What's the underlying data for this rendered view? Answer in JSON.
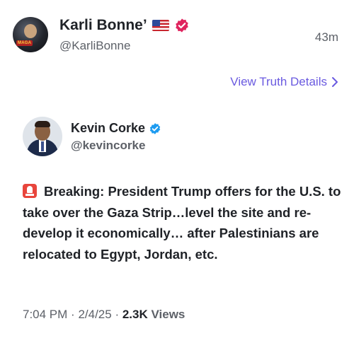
{
  "header": {
    "display_name": "Karli Bonne’",
    "flag_icon": "us-flag-icon",
    "verified_icon": "verified-badge-icon",
    "verified_color": "#e0245e",
    "handle": "@KarliBonne",
    "time_ago": "43m",
    "avatar_badge_text": "MAGA"
  },
  "view_details": {
    "label": "View Truth Details",
    "color": "#6a5ae0"
  },
  "quoted_post": {
    "author_name": "Kevin Corke",
    "verified_color": "#1d9bf0",
    "handle": "@kevincorke",
    "siren_icon": "siren-emoji-icon",
    "body": "Breaking: President Trump offers for the U.S. to take over the Gaza Strip…level the site and re-develop it economically… after Palestinians are relocated to Egypt, Jordan, etc.",
    "time": "7:04 PM",
    "date": "2/4/25",
    "views_count": "2.3K",
    "views_label": "Views"
  }
}
